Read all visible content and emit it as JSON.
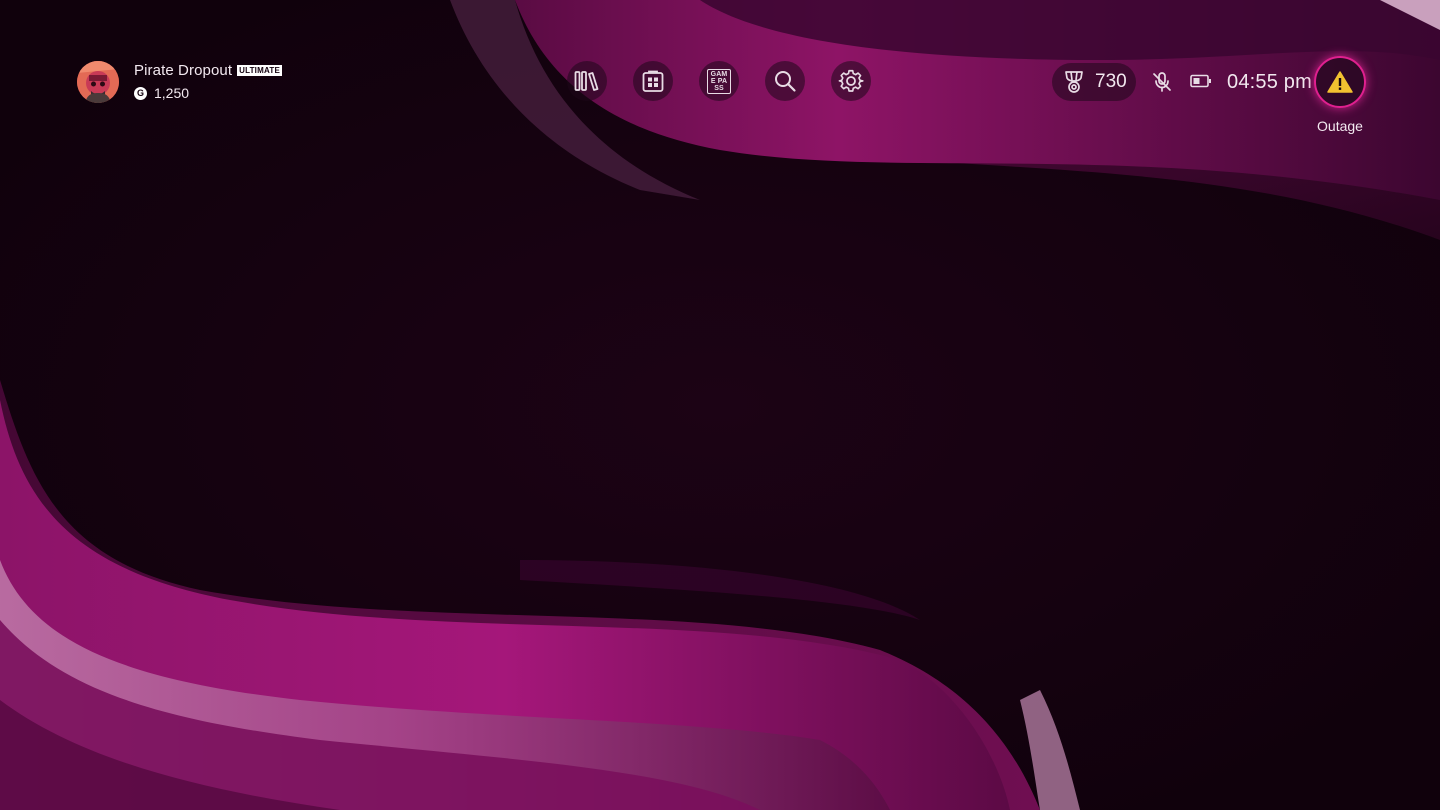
{
  "profile": {
    "gamertag": "Pirate Dropout",
    "tier_badge": "ULTIMATE",
    "gamerscore_icon": "G",
    "gamerscore": "1,250"
  },
  "nav": {
    "items": [
      {
        "name": "my-games-library",
        "icon": "library-icon"
      },
      {
        "name": "store",
        "icon": "store-icon"
      },
      {
        "name": "game-pass",
        "icon": "game-pass-icon",
        "label": "GAME PASS"
      },
      {
        "name": "search",
        "icon": "search-icon"
      },
      {
        "name": "settings",
        "icon": "gear-icon"
      }
    ]
  },
  "status": {
    "achievements_count": "730",
    "mic_state": "muted",
    "time": "04:55 pm",
    "alert_label": "Outage"
  },
  "colors": {
    "background": "#14020f",
    "wave_magenta": "#a01572",
    "wave_pink_light": "#c97ab0",
    "alert_ring": "#e0208f",
    "alert_icon": "#f2c230"
  }
}
